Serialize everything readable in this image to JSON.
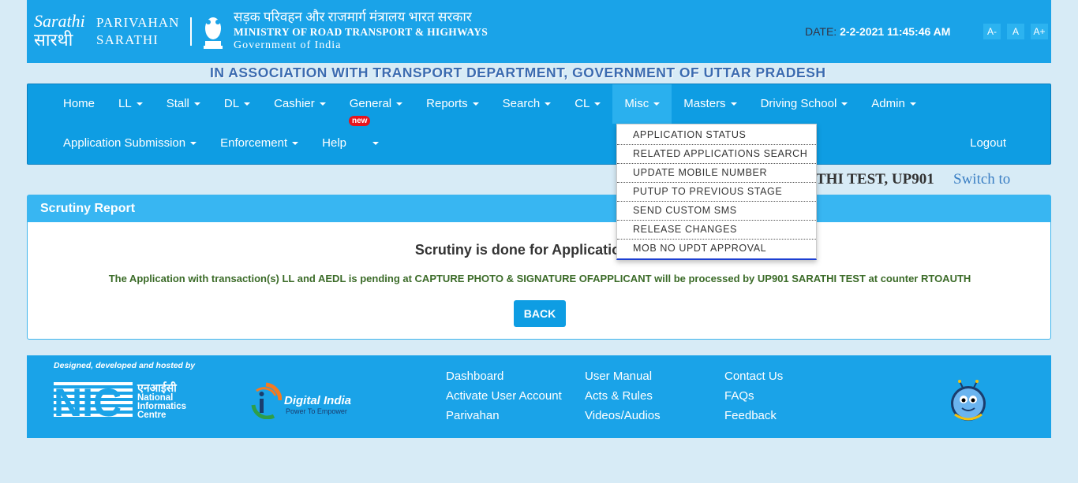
{
  "header": {
    "brand_line1": "PARIVAHAN",
    "brand_line2": "SARATHI",
    "ministry_hindi": "सड़क परिवहन और राजमार्ग मंत्रालय भारत सरकार",
    "ministry_english": "MINISTRY OF ROAD TRANSPORT & HIGHWAYS",
    "government": "Government of India",
    "date_label": "DATE:",
    "date_value": "2-2-2021 11:45:46 AM",
    "font_buttons": [
      "A-",
      "A",
      "A+"
    ]
  },
  "association": "IN ASSOCIATION WITH TRANSPORT DEPARTMENT, GOVERNMENT OF UTTAR PRADESH",
  "nav": {
    "row1": [
      "Home",
      "LL",
      "Stall",
      "DL",
      "Cashier",
      "General",
      "Reports",
      "Search",
      "CL",
      "Misc",
      "Masters",
      "Driving School",
      "Admin"
    ],
    "row2": [
      "Application Submission",
      "Enforcement",
      "Help"
    ],
    "help_badge": "new",
    "logout": "Logout"
  },
  "misc_menu": [
    "APPLICATION STATUS",
    "RELATED APPLICATIONS SEARCH",
    "UPDATE MOBILE NUMBER",
    "PUTUP TO PREVIOUS STAGE",
    "SEND CUSTOM SMS",
    "RELEASE CHANGES",
    "MOB NO UPDT APPROVAL"
  ],
  "user": {
    "info": "THI TEST, UP901",
    "switch_to": "Switch to"
  },
  "panel": {
    "title": "Scrutiny Report",
    "message": "Scrutiny is done for Application Num",
    "pending": "The Application with transaction(s) LL and AEDL is pending at CAPTURE PHOTO & SIGNATURE OFAPPLICANT will be processed by UP901 SARATHI TEST at counter RTOAUTH",
    "back_button": "BACK"
  },
  "footer": {
    "designed_by": "Designed, developed and hosted by",
    "nic_hindi": "एनआईसी",
    "nic_name": [
      "National",
      "Informatics",
      "Centre"
    ],
    "nic_logo_text": "NIC",
    "digital_india": "Digital India",
    "digital_india_tag": "Power To Empower",
    "col1": [
      "Dashboard",
      "Activate User Account",
      "Parivahan"
    ],
    "col2": [
      "User Manual",
      "Acts & Rules",
      "Videos/Audios"
    ],
    "col3": [
      "Contact Us",
      "FAQs",
      "Feedback"
    ]
  },
  "colors": {
    "header_bg": "#1aa3e8",
    "nav_bg": "#0e9de3",
    "panel_title_bg": "#38b6f2",
    "page_bg": "#d7ebf6"
  }
}
